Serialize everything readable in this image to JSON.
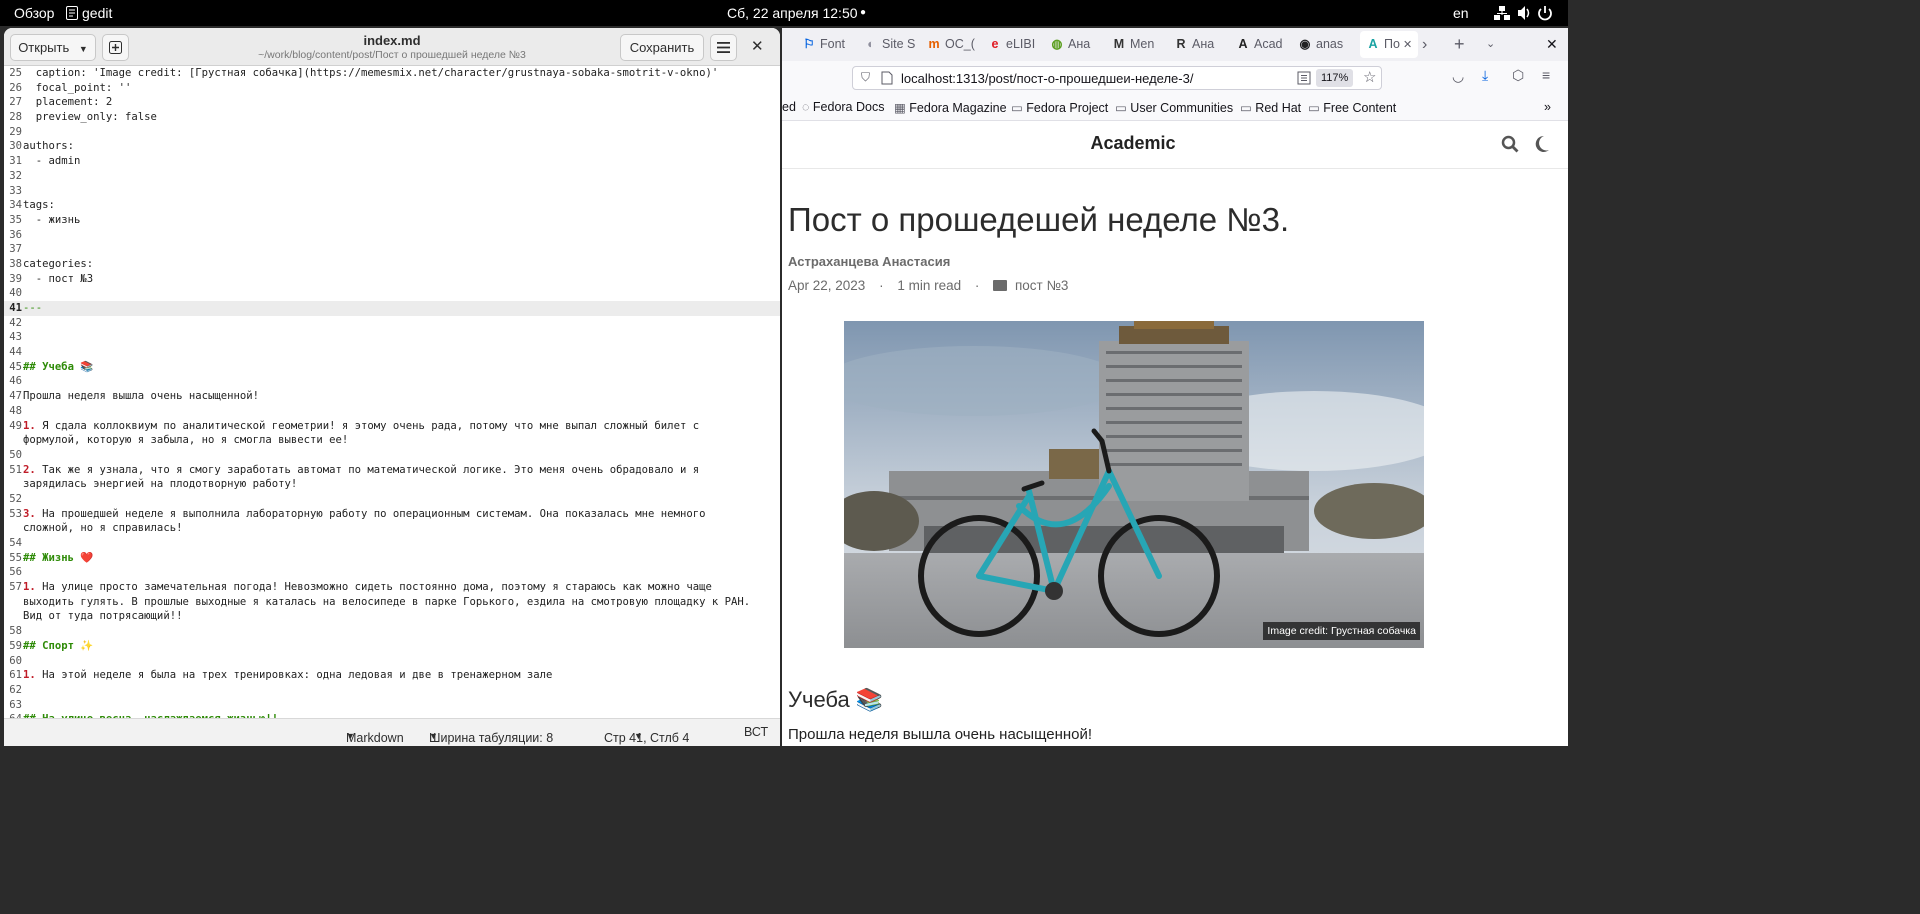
{
  "topbar": {
    "activities": "Обзор",
    "app_name": "gedit",
    "clock": "Сб, 22 апреля  12:50",
    "keyboard_layout": "en"
  },
  "gedit": {
    "open_label": "Открыть",
    "title": "index.md",
    "subtitle": "~/work/blog/content/post/Пост о прошедшей неделе №3",
    "save_label": "Сохранить",
    "lines": [
      {
        "n": "25",
        "t": "  caption: 'Image credit: [Грустная собачка](https://memesmix.net/character/grustnaya-sobaka-smotrit-v-okno)'"
      },
      {
        "n": "26",
        "t": "  focal_point: ''"
      },
      {
        "n": "27",
        "t": "  placement: 2"
      },
      {
        "n": "28",
        "t": "  preview_only: false"
      },
      {
        "n": "29",
        "t": ""
      },
      {
        "n": "30",
        "t": "authors:"
      },
      {
        "n": "31",
        "t": "  - admin"
      },
      {
        "n": "32",
        "t": ""
      },
      {
        "n": "33",
        "t": ""
      },
      {
        "n": "34",
        "t": "tags:"
      },
      {
        "n": "35",
        "t": "  - жизнь"
      },
      {
        "n": "36",
        "t": ""
      },
      {
        "n": "37",
        "t": ""
      },
      {
        "n": "38",
        "t": "categories:"
      },
      {
        "n": "39",
        "t": "  - пост №3"
      },
      {
        "n": "40",
        "t": ""
      },
      {
        "n": "41",
        "t": "---"
      },
      {
        "n": "42",
        "t": ""
      },
      {
        "n": "43",
        "t": ""
      },
      {
        "n": "44",
        "t": ""
      },
      {
        "n": "45",
        "t": "## Учеба 📚"
      },
      {
        "n": "46",
        "t": ""
      },
      {
        "n": "47",
        "t": "Прошла неделя вышла очень насыщенной!"
      },
      {
        "n": "48",
        "t": ""
      },
      {
        "n": "49",
        "t": "1. Я сдала коллоквиум по аналитической геометрии! я этому очень рада, потому что мне выпал сложный билет с"
      },
      {
        "n": "",
        "t": "формулой, которую я забыла, но я смогла вывести ее!"
      },
      {
        "n": "50",
        "t": ""
      },
      {
        "n": "51",
        "t": "2. Так же я узнала, что я смогу заработать автомат по математической логике. Это меня очень обрадовало и я"
      },
      {
        "n": "",
        "t": "зарядилась энергией на плодотворную работу!"
      },
      {
        "n": "52",
        "t": ""
      },
      {
        "n": "53",
        "t": "3. На прошедшей неделе я выполнила лабораторную работу по операционным системам. Она показалась мне немного"
      },
      {
        "n": "",
        "t": "сложной, но я справилась!"
      },
      {
        "n": "54",
        "t": ""
      },
      {
        "n": "55",
        "t": "## Жизнь ❤️"
      },
      {
        "n": "56",
        "t": ""
      },
      {
        "n": "57",
        "t": "1. На улице просто замечательная погода! Невозможно сидеть постоянно дома, поэтому я стараюсь как можно чаще"
      },
      {
        "n": "",
        "t": "выходить гулять. В прошлые выходные я каталась на велосипеде в парке Горького, ездила на смотровую площадку к РАН."
      },
      {
        "n": "",
        "t": "Вид от туда потрясающий!!"
      },
      {
        "n": "58",
        "t": ""
      },
      {
        "n": "59",
        "t": "## Спорт ✨"
      },
      {
        "n": "60",
        "t": ""
      },
      {
        "n": "61",
        "t": "1. На этой неделе я была на трех тренировках: одна ледовая и две в тренажерном зале"
      },
      {
        "n": "62",
        "t": ""
      },
      {
        "n": "63",
        "t": ""
      },
      {
        "n": "64",
        "t": "## На улице весна, наслаждаемся жизнью!!"
      }
    ],
    "status": {
      "language": "Markdown",
      "tab_width": "Ширина табуляции: 8",
      "position": "Стр 41, Стлб 4",
      "insert_mode": "ВСТ"
    }
  },
  "firefox": {
    "tabs": [
      {
        "fav": "⚐",
        "label": "Font",
        "color": "#0060df"
      },
      {
        "fav": "◐",
        "label": "Site S",
        "color": "#8f8f9d"
      },
      {
        "fav": "m",
        "label": "ОС_(",
        "color": "#e66000"
      },
      {
        "fav": "e",
        "label": "eLIBI",
        "color": "#e01b24"
      },
      {
        "fav": "◍",
        "label": "Ана",
        "color": "#5a9e1e"
      },
      {
        "fav": "M",
        "label": "Men",
        "color": "#333333"
      },
      {
        "fav": "R",
        "label": "Ана",
        "color": "#333333"
      },
      {
        "fav": "A",
        "label": "Acad",
        "color": "#222222"
      },
      {
        "fav": "◉",
        "label": "anas",
        "color": "#222222"
      },
      {
        "fav": "A",
        "label": "По",
        "color": "#1aa3a3"
      }
    ],
    "url": "localhost:1313/post/пост-о-прошедшеи-неделе-3/",
    "zoom": "117%",
    "bookmarks": [
      "ed",
      "Fedora Docs",
      "Fedora Magazine",
      "Fedora Project",
      "User Communities",
      "Red Hat",
      "Free Content"
    ],
    "page": {
      "site_title": "Academic",
      "post_title": "Пост о прошедешей неделе №3.",
      "author": "Астраханцева Анастасия",
      "date": "Apr 22, 2023",
      "read_time": "1 min read",
      "category": "пост №3",
      "image_caption": "Image credit: Грустная собачка",
      "section_heading": "Учеба 📚",
      "section_text": "Прошла неделя вышла очень насыщенной!"
    }
  }
}
